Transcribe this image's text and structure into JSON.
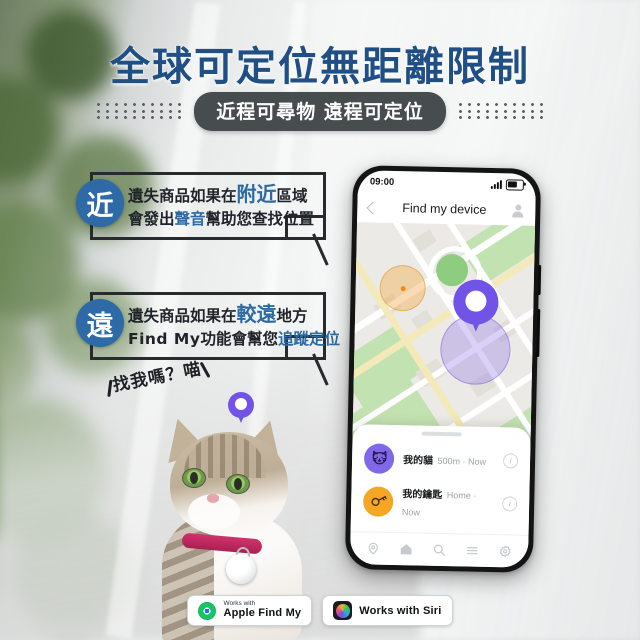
{
  "header": {
    "headline": "全球可定位無距離限制",
    "pill": "近程可尋物 遠程可定位"
  },
  "callouts": [
    {
      "badge": "近",
      "line1_a": "遺失商品如果在",
      "line1_hi": "附近",
      "line1_b": "區域",
      "line2_a": "會發出",
      "line2_hi": "聲音",
      "line2_b": "幫助您查找位置"
    },
    {
      "badge": "遠",
      "line1_a": "遺失商品如果在",
      "line1_hi": "較遠",
      "line1_b": "地方",
      "line2_a": "Find My",
      "line2_b": "功能會幫您",
      "line2_hi": "追蹤定位"
    }
  ],
  "handwriting": "找我嗎？喵",
  "phone": {
    "status": {
      "time": "09:00",
      "signal_icon": "signal-bars-icon",
      "battery_icon": "battery-icon"
    },
    "nav": {
      "back_icon": "chevron-left-icon",
      "title": "Find my device",
      "avatar_icon": "person-avatar-icon"
    },
    "map": {
      "pin_icon": "map-pin-icon",
      "near_radius_color": "#f3a94a",
      "far_radius_color": "#8168e8"
    },
    "devices": [
      {
        "icon": "cat-icon",
        "icon_color": "#8168e8",
        "name": "我的貓",
        "subtitle": "500m · Now",
        "info_icon": "info-icon"
      },
      {
        "icon": "key-icon",
        "icon_color": "#f5a623",
        "name": "我的鑰匙",
        "subtitle": "Home · Now",
        "info_icon": "info-icon"
      }
    ],
    "tabs": [
      {
        "icon": "location-pin-icon"
      },
      {
        "icon": "home-icon"
      },
      {
        "icon": "search-icon"
      },
      {
        "icon": "list-menu-icon"
      },
      {
        "icon": "settings-gear-icon"
      }
    ]
  },
  "badges": [
    {
      "icon": "apple-find-my-icon",
      "small": "Works with",
      "big": "Apple Find My"
    },
    {
      "icon": "siri-icon",
      "big": "Works with Siri"
    }
  ],
  "colors": {
    "headline": "#1f4f85",
    "pill_bg": "#474c4f",
    "badge_blue": "#2e6aa8",
    "highlight_blue": "#2d6aa3",
    "purple": "#7253e8",
    "orange": "#f5a623"
  }
}
